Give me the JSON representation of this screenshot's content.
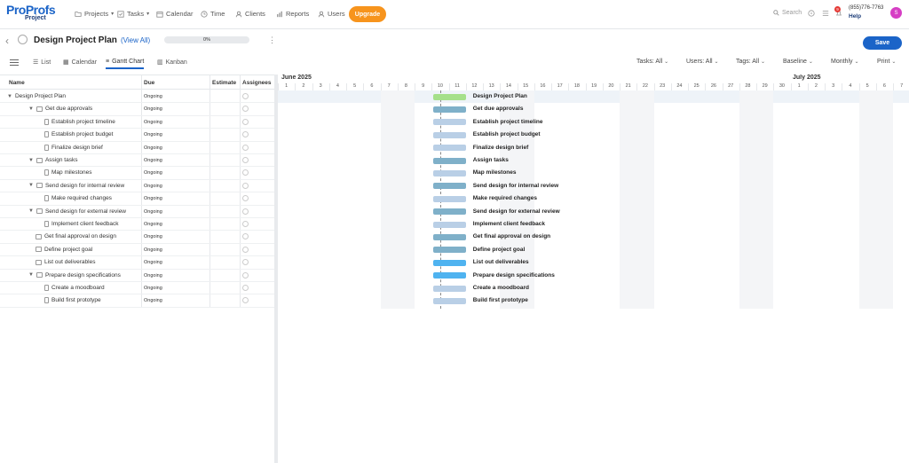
{
  "topnav": {
    "logo": {
      "brand": "ProProfs",
      "sub": "Project"
    },
    "items": [
      {
        "label": "Projects",
        "icon": "folder-icon"
      },
      {
        "label": "Tasks",
        "icon": "tasks-icon"
      },
      {
        "label": "Calendar",
        "icon": "calendar-icon"
      },
      {
        "label": "Time",
        "icon": "clock-icon"
      },
      {
        "label": "Clients",
        "icon": "clients-icon"
      },
      {
        "label": "Reports",
        "icon": "reports-icon"
      },
      {
        "label": "Users",
        "icon": "user-icon"
      }
    ],
    "upgrade_label": "Upgrade",
    "search_placeholder": "Search",
    "notification_count": "9",
    "phone": "(855)776-7763",
    "help_label": "Help",
    "avatar_initial": "S"
  },
  "project": {
    "title": "Design Project Plan",
    "view_all": "(View All)",
    "progress_label": "0%",
    "progress_value": 0,
    "save_label": "Save"
  },
  "views": {
    "tabs": [
      "List",
      "Calendar",
      "Gantt Chart",
      "Kanban"
    ],
    "active": "Gantt Chart"
  },
  "filters": {
    "tasks": "Tasks: All",
    "users": "Users: All",
    "tags": "Tags: All",
    "baseline": "Baseline",
    "scale": "Monthly",
    "print": "Print"
  },
  "grid": {
    "columns": {
      "name": "Name",
      "due": "Due",
      "estimate": "Estimate",
      "assignees": "Assignees"
    },
    "rows": [
      {
        "name": "Design Project Plan",
        "due": "Ongoing",
        "level": 0,
        "kind": "project"
      },
      {
        "name": "Get due approvals",
        "due": "Ongoing",
        "level": 1,
        "kind": "group"
      },
      {
        "name": "Establish project timeline",
        "due": "Ongoing",
        "level": 2,
        "kind": "task"
      },
      {
        "name": "Establish project budget",
        "due": "Ongoing",
        "level": 2,
        "kind": "task"
      },
      {
        "name": "Finalize design brief",
        "due": "Ongoing",
        "level": 2,
        "kind": "task"
      },
      {
        "name": "Assign tasks",
        "due": "Ongoing",
        "level": 1,
        "kind": "group"
      },
      {
        "name": "Map milestones",
        "due": "Ongoing",
        "level": 2,
        "kind": "task"
      },
      {
        "name": "Send design for internal review",
        "due": "Ongoing",
        "level": 1,
        "kind": "group"
      },
      {
        "name": "Make required changes",
        "due": "Ongoing",
        "level": 2,
        "kind": "task"
      },
      {
        "name": "Send design for external review",
        "due": "Ongoing",
        "level": 1,
        "kind": "group"
      },
      {
        "name": "Implement client feedback",
        "due": "Ongoing",
        "level": 2,
        "kind": "task"
      },
      {
        "name": "Get final approval on design",
        "due": "Ongoing",
        "level": 1,
        "kind": "item"
      },
      {
        "name": "Define project goal",
        "due": "Ongoing",
        "level": 1,
        "kind": "item"
      },
      {
        "name": "List out deliverables",
        "due": "Ongoing",
        "level": 1,
        "kind": "item"
      },
      {
        "name": "Prepare design specifications",
        "due": "Ongoing",
        "level": 1,
        "kind": "group"
      },
      {
        "name": "Create a moodboard",
        "due": "Ongoing",
        "level": 2,
        "kind": "task"
      },
      {
        "name": "Build first prototype",
        "due": "Ongoing",
        "level": 2,
        "kind": "task"
      }
    ]
  },
  "gantt": {
    "months": [
      "June 2025",
      "July 2025"
    ],
    "days": [
      "1",
      "2",
      "3",
      "4",
      "5",
      "6",
      "7",
      "8",
      "9",
      "10",
      "11",
      "12",
      "13",
      "14",
      "15",
      "16",
      "17",
      "18",
      "19",
      "20",
      "21",
      "22",
      "23",
      "24",
      "25",
      "26",
      "27",
      "28",
      "29",
      "30",
      "1",
      "2",
      "3",
      "4",
      "5",
      "6",
      "7"
    ],
    "weekend_day_indices": [
      6,
      7,
      13,
      14,
      20,
      21,
      27,
      28,
      34,
      35
    ],
    "today_day_index": 9,
    "bar_start_day_index": 9,
    "bar_span_days": 2,
    "bar_colors": {
      "project": "#a5e08a",
      "group": "#7fb0c9",
      "task": "#b9cfe6",
      "item_a": "#7fb0c9",
      "item_b": "#4fb3f0"
    },
    "bar_kinds": [
      "project",
      "group",
      "task",
      "task",
      "task",
      "group",
      "task",
      "group",
      "task",
      "group",
      "task",
      "group",
      "group",
      "item_b",
      "item_b",
      "task",
      "task"
    ]
  }
}
